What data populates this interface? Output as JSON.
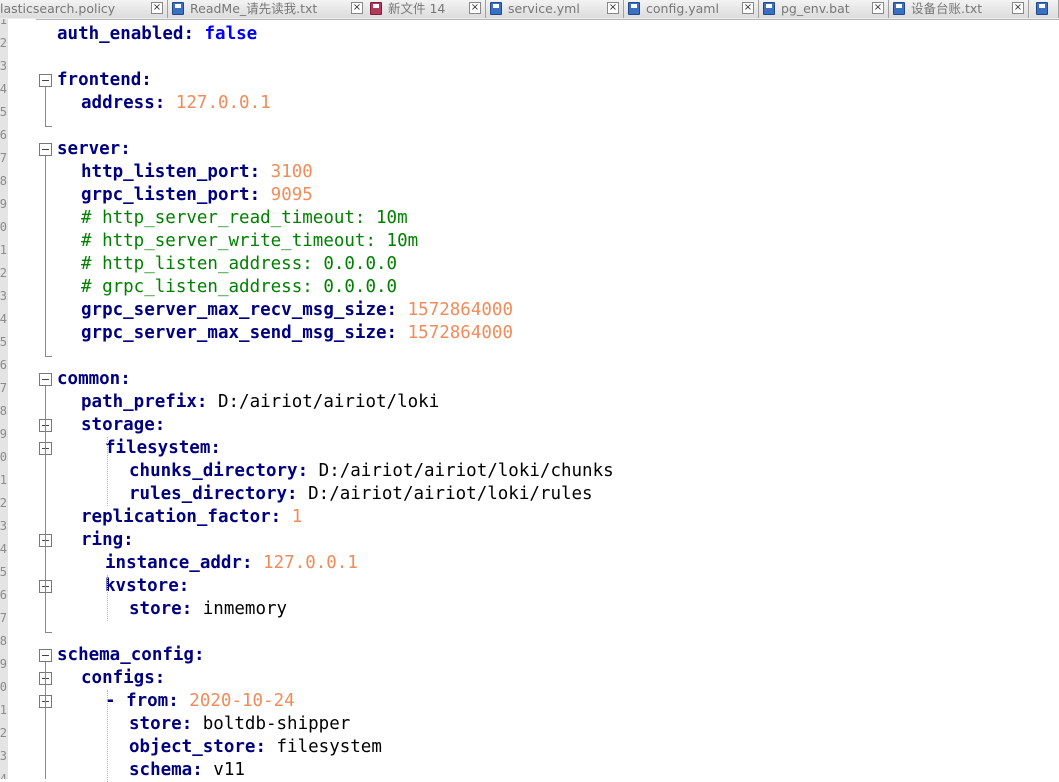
{
  "tabs": [
    {
      "label": "lasticsearch.policy",
      "icon": "none"
    },
    {
      "label": "ReadMe_请先读我.txt",
      "icon": "blue"
    },
    {
      "label": "新文件 14",
      "icon": "red"
    },
    {
      "label": "service.yml",
      "icon": "blue"
    },
    {
      "label": "config.yaml",
      "icon": "blue"
    },
    {
      "label": "pg_env.bat",
      "icon": "blue"
    },
    {
      "label": "设备台账.txt",
      "icon": "blue"
    }
  ],
  "line_numbers": [
    "1",
    "2",
    "3",
    "4",
    "5",
    "6",
    "7",
    "8",
    "9",
    "0",
    "1",
    "2",
    "3",
    "4",
    "5",
    "6",
    "7",
    "8",
    "9",
    "0",
    "1",
    "2",
    "3",
    "4",
    "5",
    "6",
    "7",
    "8",
    "9",
    "0",
    "1",
    "2",
    "3",
    "4"
  ],
  "code_lines": [
    {
      "indent": 0,
      "key": "auth_enabled",
      "sep": ": ",
      "value": "false",
      "type": "bool"
    },
    {
      "indent": 0,
      "key": "",
      "sep": "",
      "value": "",
      "type": "blank"
    },
    {
      "indent": 0,
      "key": "frontend",
      "sep": ":",
      "value": "",
      "type": "key"
    },
    {
      "indent": 1,
      "key": "address",
      "sep": ": ",
      "value": "127.0.0.1",
      "type": "num"
    },
    {
      "indent": 0,
      "key": "",
      "sep": "",
      "value": "",
      "type": "blank"
    },
    {
      "indent": 0,
      "key": "server",
      "sep": ":",
      "value": "",
      "type": "key"
    },
    {
      "indent": 1,
      "key": "http_listen_port",
      "sep": ": ",
      "value": "3100",
      "type": "num"
    },
    {
      "indent": 1,
      "key": "grpc_listen_port",
      "sep": ": ",
      "value": "9095",
      "type": "num"
    },
    {
      "indent": 1,
      "key": "",
      "sep": "",
      "value": "# http_server_read_timeout: 10m",
      "type": "comment"
    },
    {
      "indent": 1,
      "key": "",
      "sep": "",
      "value": "# http_server_write_timeout: 10m",
      "type": "comment"
    },
    {
      "indent": 1,
      "key": "",
      "sep": "",
      "value": "# http_listen_address: 0.0.0.0",
      "type": "comment"
    },
    {
      "indent": 1,
      "key": "",
      "sep": "",
      "value": "# grpc_listen_address: 0.0.0.0",
      "type": "comment"
    },
    {
      "indent": 1,
      "key": "grpc_server_max_recv_msg_size",
      "sep": ": ",
      "value": "1572864000",
      "type": "num"
    },
    {
      "indent": 1,
      "key": "grpc_server_max_send_msg_size",
      "sep": ": ",
      "value": "1572864000",
      "type": "num"
    },
    {
      "indent": 0,
      "key": "",
      "sep": "",
      "value": "",
      "type": "blank"
    },
    {
      "indent": 0,
      "key": "common",
      "sep": ":",
      "value": "",
      "type": "key"
    },
    {
      "indent": 1,
      "key": "path_prefix",
      "sep": ": ",
      "value": "D:/airiot/airiot/loki",
      "type": "str"
    },
    {
      "indent": 1,
      "key": "storage",
      "sep": ":",
      "value": "",
      "type": "key"
    },
    {
      "indent": 2,
      "key": "filesystem",
      "sep": ":",
      "value": "",
      "type": "key"
    },
    {
      "indent": 3,
      "key": "chunks_directory",
      "sep": ": ",
      "value": "D:/airiot/airiot/loki/chunks",
      "type": "str"
    },
    {
      "indent": 3,
      "key": "rules_directory",
      "sep": ": ",
      "value": "D:/airiot/airiot/loki/rules",
      "type": "str"
    },
    {
      "indent": 1,
      "key": "replication_factor",
      "sep": ": ",
      "value": "1",
      "type": "num"
    },
    {
      "indent": 1,
      "key": "ring",
      "sep": ":",
      "value": "",
      "type": "key"
    },
    {
      "indent": 2,
      "key": "instance_addr",
      "sep": ": ",
      "value": "127.0.0.1",
      "type": "num"
    },
    {
      "indent": 2,
      "key": "kvstore",
      "sep": ":",
      "value": "",
      "type": "key"
    },
    {
      "indent": 3,
      "key": "store",
      "sep": ": ",
      "value": "inmemory",
      "type": "str"
    },
    {
      "indent": 0,
      "key": "",
      "sep": "",
      "value": "",
      "type": "blank"
    },
    {
      "indent": 0,
      "key": "schema_config",
      "sep": ":",
      "value": "",
      "type": "key"
    },
    {
      "indent": 1,
      "key": "configs",
      "sep": ":",
      "value": "",
      "type": "key"
    },
    {
      "indent": 2,
      "key": "- from",
      "sep": ": ",
      "value": "2020-10-24",
      "type": "num"
    },
    {
      "indent": 3,
      "key": "store",
      "sep": ": ",
      "value": "boltdb-shipper",
      "type": "str"
    },
    {
      "indent": 3,
      "key": "object_store",
      "sep": ": ",
      "value": "filesystem",
      "type": "str"
    },
    {
      "indent": 3,
      "key": "schema",
      "sep": ": ",
      "value": "v11",
      "type": "str"
    }
  ],
  "colors": {
    "key": "#000080",
    "number": "#f08c5a",
    "comment": "#008000",
    "bool": "#0000ff",
    "string": "#000000"
  },
  "icons": {
    "tab_file": "file-icon",
    "tab_close": "close-icon",
    "fold": "fold-minus-icon",
    "save": "save-icon"
  }
}
